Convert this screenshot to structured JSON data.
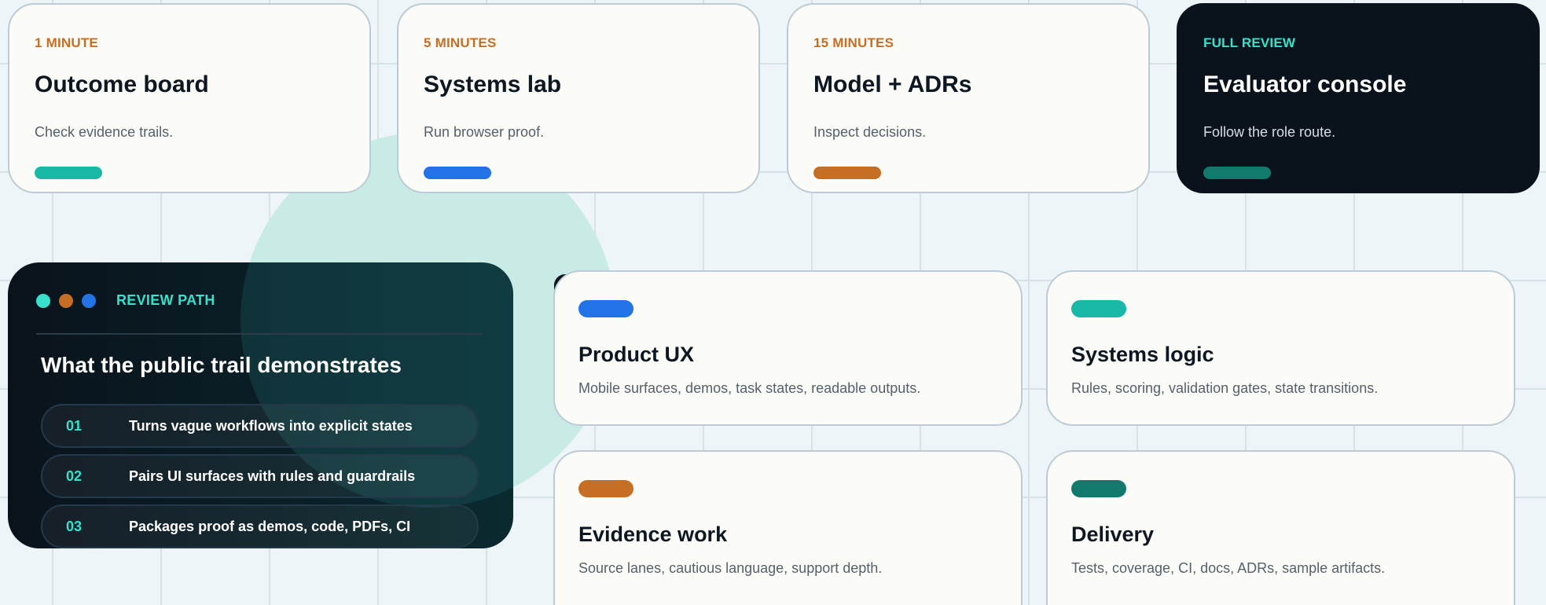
{
  "top_cards": [
    {
      "kicker": "1 MINUTE",
      "title": "Outcome board",
      "desc": "Check evidence trails.",
      "accent": "#1ab8a6"
    },
    {
      "kicker": "5 MINUTES",
      "title": "Systems lab",
      "desc": "Run browser proof.",
      "accent": "#2173e6"
    },
    {
      "kicker": "15 MINUTES",
      "title": "Model + ADRs",
      "desc": "Inspect decisions.",
      "accent": "#c56e24"
    },
    {
      "kicker": "FULL REVIEW",
      "title": "Evaluator console",
      "desc": "Follow the role route.",
      "accent": "#117a6c"
    }
  ],
  "review_path": {
    "label": "REVIEW PATH",
    "heading": "What the public trail demonstrates",
    "dots": [
      "#38e0cc",
      "#c56e24",
      "#2173e6"
    ],
    "items": [
      {
        "num": "01",
        "text": "Turns vague workflows into explicit states"
      },
      {
        "num": "02",
        "text": "Pairs UI surfaces with rules and guardrails"
      },
      {
        "num": "03",
        "text": "Packages proof as demos, code, PDFs, CI"
      }
    ]
  },
  "capabilities": [
    {
      "title": "Product UX",
      "desc": "Mobile surfaces, demos, task states, readable outputs.",
      "accent": "#2173e6"
    },
    {
      "title": "Systems logic",
      "desc": "Rules, scoring, validation gates, state transitions.",
      "accent": "#1ab8a6"
    },
    {
      "title": "Evidence work",
      "desc": "Source lanes, cautious language, support depth.",
      "accent": "#c56e24"
    },
    {
      "title": "Delivery",
      "desc": "Tests, coverage, CI, docs, ADRs, sample artifacts.",
      "accent": "#117a6c"
    }
  ],
  "colors": {
    "background": "#eef5f8",
    "dark": "#0a131c",
    "teal": "#38e0cc",
    "orange": "#c56e24",
    "blue": "#2173e6"
  }
}
